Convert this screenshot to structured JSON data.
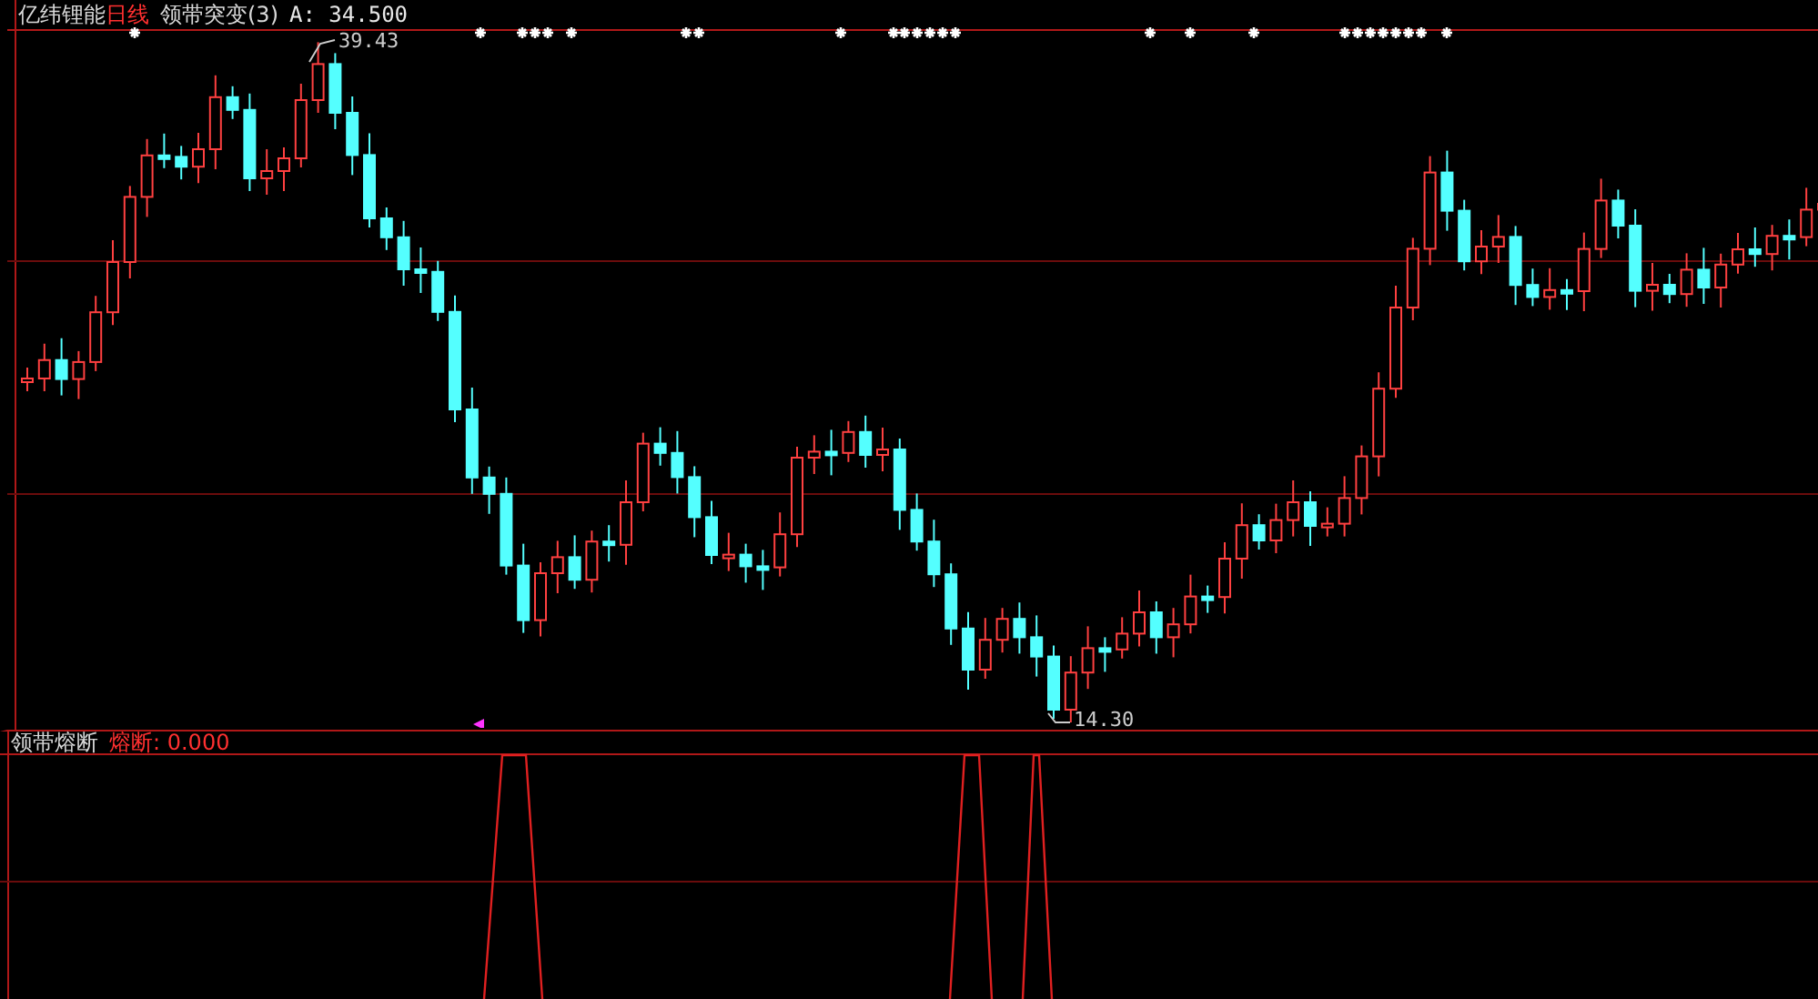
{
  "header": {
    "stock_name": "亿纬锂能",
    "period": "日线",
    "indicator": "领带突变(3)",
    "reading": "A: 34.500"
  },
  "high_label": "39.43",
  "low_label": "14.30",
  "lower_panel": {
    "indicator": "领带熔断",
    "series_label": "熔断: 0.000"
  }
}
